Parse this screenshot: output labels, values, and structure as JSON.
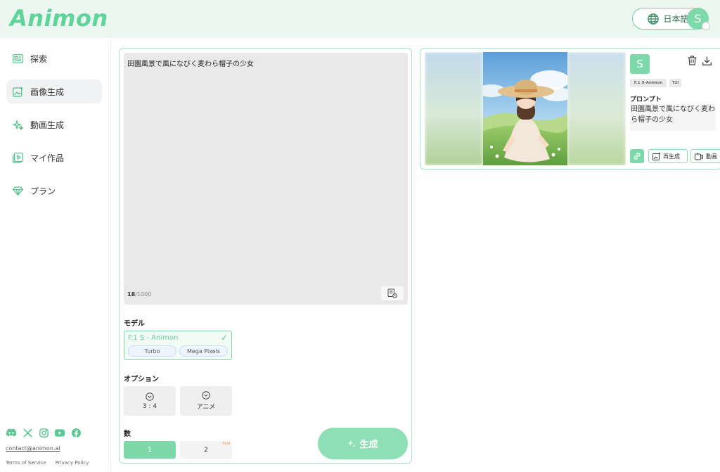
{
  "header": {
    "logo": "Animon",
    "language_label": "日本語",
    "avatar_letter": "S"
  },
  "sidebar": {
    "items": [
      {
        "label": "探索",
        "icon": "explore-icon",
        "active": false
      },
      {
        "label": "画像生成",
        "icon": "image-generate-icon",
        "active": true
      },
      {
        "label": "動画生成",
        "icon": "sparkle-icon",
        "active": false
      },
      {
        "label": "マイ作品",
        "icon": "my-works-icon",
        "active": false
      },
      {
        "label": "プラン",
        "icon": "diamond-icon",
        "active": false
      }
    ],
    "social_icons": [
      "discord-icon",
      "x-icon",
      "instagram-icon",
      "youtube-icon",
      "facebook-icon"
    ],
    "contact_email": "contact@animon.ai",
    "terms_label": "Terms of Service",
    "privacy_label": "Privacy Policy"
  },
  "generator": {
    "prompt_text": "田園風景で風になびく麦わら帽子の少女",
    "char_count": "18",
    "char_max": "/1000",
    "model_label": "モデル",
    "model": {
      "name": "F.1 S - Animon",
      "check": "✓",
      "tags": [
        "Turbo",
        "Mega Pixels"
      ]
    },
    "options_label": "オプション",
    "options": [
      {
        "value": "3 : 4"
      },
      {
        "value": "アニメ"
      }
    ],
    "count_label": "数",
    "counts": [
      {
        "value": "1",
        "active": true
      },
      {
        "value": "2",
        "active": false,
        "tag": "Paid"
      }
    ],
    "generate_label": "生成"
  },
  "result": {
    "avatar_letter": "S",
    "tags": [
      "F.1 S-Animon",
      "T2I"
    ],
    "prompt_label": "プロンプト",
    "prompt_text": "田園風景で風になびく麦わら帽子の少女",
    "actions": {
      "regenerate_label": "再生成",
      "video_label": "動画"
    }
  },
  "colors": {
    "brand": "#5ed39a",
    "accent_light": "#7ed9aa",
    "header_bg": "#edf7f1"
  }
}
